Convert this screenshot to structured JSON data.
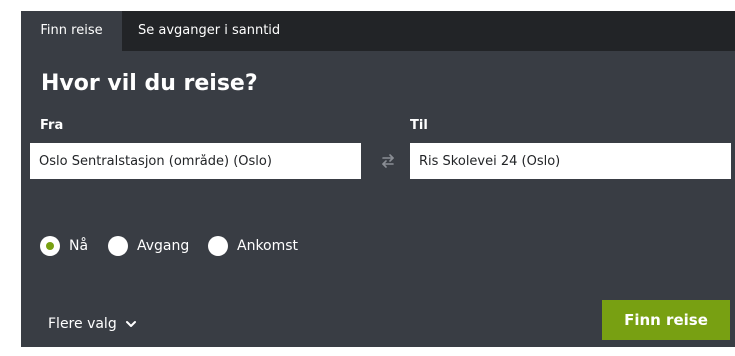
{
  "tabs": [
    {
      "label": "Finn reise",
      "active": true
    },
    {
      "label": "Se avganger i sanntid",
      "active": false
    }
  ],
  "heading": "Hvor vil du reise?",
  "from": {
    "label": "Fra",
    "value": "Oslo Sentralstasjon (område) (Oslo)"
  },
  "to": {
    "label": "Til",
    "value": "Ris Skolevei 24 (Oslo)"
  },
  "swap_icon": "swap-arrows-icon",
  "time_options": [
    {
      "label": "Nå",
      "selected": true
    },
    {
      "label": "Avgang",
      "selected": false
    },
    {
      "label": "Ankomst",
      "selected": false
    }
  ],
  "more_options": {
    "label": "Flere valg",
    "icon": "chevron-down-icon"
  },
  "submit_label": "Finn reise",
  "colors": {
    "panel": "#393d44",
    "tabbar": "#222427",
    "accent": "#78a012",
    "text": "#ffffff"
  }
}
